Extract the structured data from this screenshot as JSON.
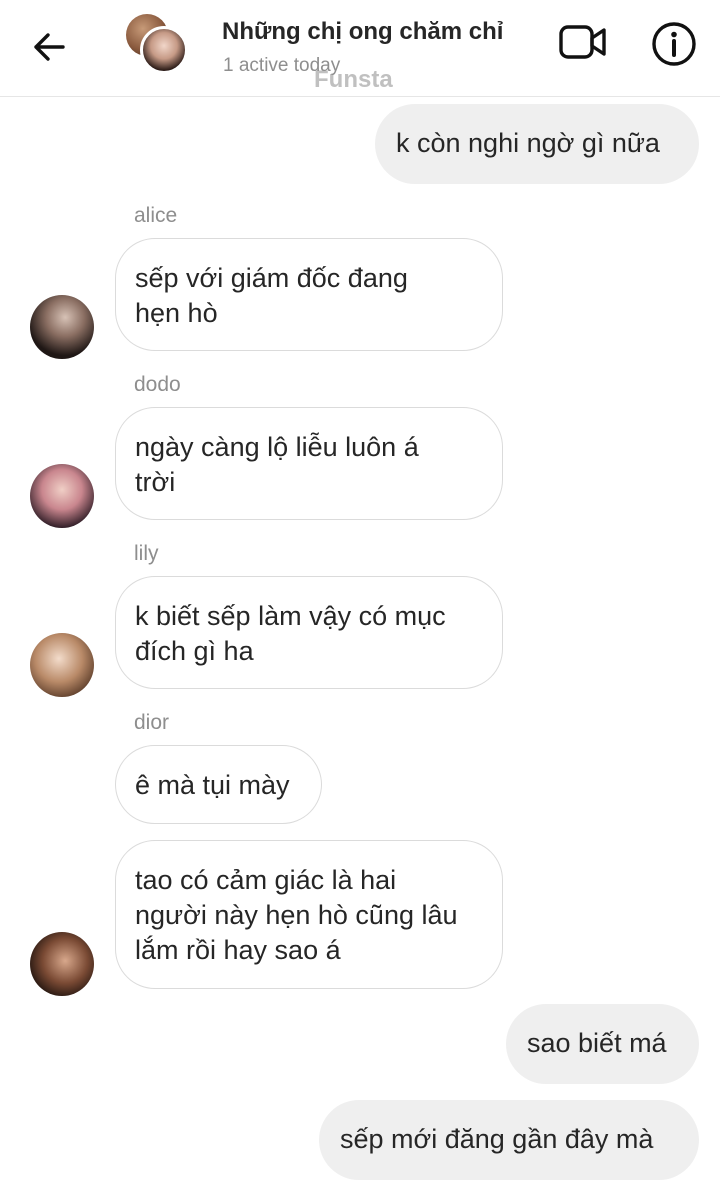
{
  "header": {
    "title": "Những chị ong chăm chỉ",
    "subtitle": "1 active today",
    "watermark": "Funsta",
    "back_icon": "arrow-left-icon",
    "video_icon": "video-camera-icon",
    "info_icon": "info-icon"
  },
  "messages": [
    {
      "direction": "out",
      "text": "k còn nghi ngờ gì nữa"
    },
    {
      "direction": "in",
      "sender": "alice",
      "text": "sếp với giám đốc đang hẹn hò",
      "lines": [
        "sếp với giám đốc đang",
        "hẹn hò"
      ]
    },
    {
      "direction": "in",
      "sender": "dodo",
      "text": "ngày càng lộ liễu luôn á trời",
      "lines": [
        "ngày càng lộ liễu luôn á",
        "trời"
      ]
    },
    {
      "direction": "in",
      "sender": "lily",
      "text": "k biết sếp làm vậy có mục đích gì ha",
      "lines": [
        "k biết sếp làm vậy có mục",
        "đích gì ha"
      ]
    },
    {
      "direction": "in",
      "sender": "dior",
      "text": "ê mà tụi mày"
    },
    {
      "direction": "in",
      "text": "tao có cảm giác là hai người này hẹn hò cũng lâu lắm rồi hay sao á",
      "lines": [
        "tao có cảm giác là hai",
        "người này hẹn hò cũng lâu",
        "lắm rồi hay sao á"
      ]
    },
    {
      "direction": "out",
      "text": "sao biết má"
    },
    {
      "direction": "out",
      "text": "sếp mới đăng gần đây mà"
    }
  ],
  "colors": {
    "outgoing_bubble": "#efefef",
    "incoming_border": "#dbdbdb",
    "text": "#262626",
    "muted": "#8e8e8e"
  }
}
